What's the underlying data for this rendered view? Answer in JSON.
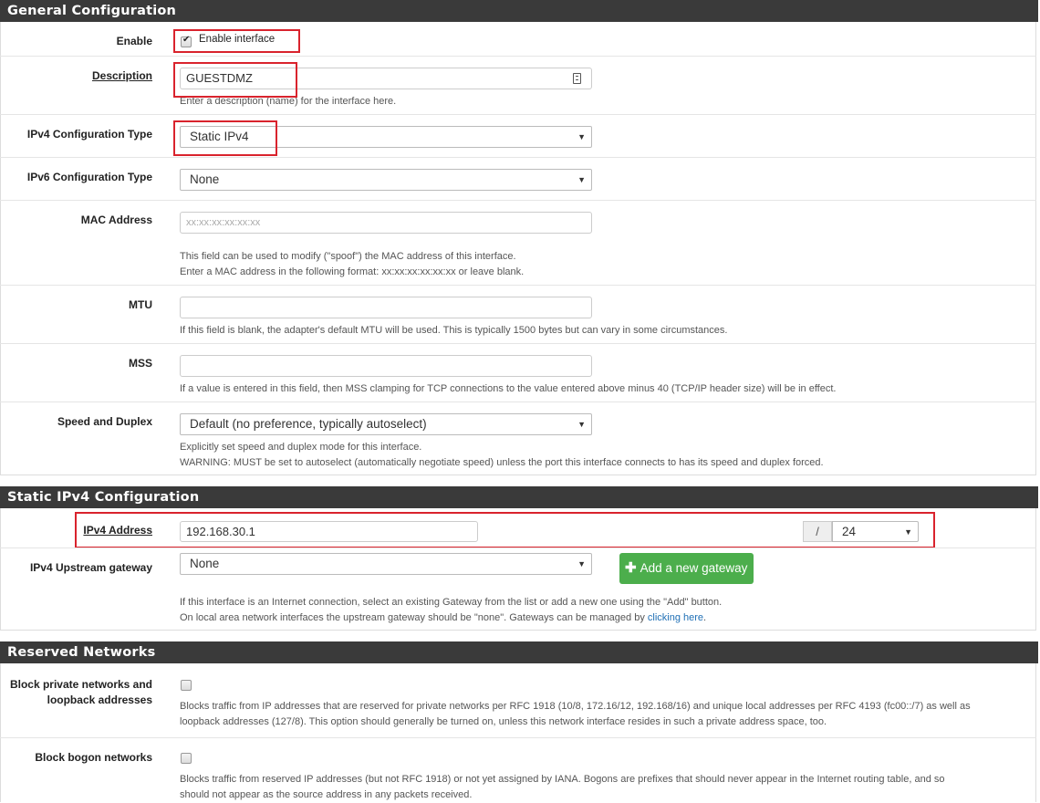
{
  "general": {
    "heading": "General Configuration",
    "enable": {
      "label": "Enable",
      "checkbox_label": "Enable interface",
      "checked": true
    },
    "description": {
      "label": "Description",
      "value": "GUESTDMZ",
      "help": "Enter a description (name) for the interface here."
    },
    "ipv4_type": {
      "label": "IPv4 Configuration Type",
      "value": "Static IPv4"
    },
    "ipv6_type": {
      "label": "IPv6 Configuration Type",
      "value": "None"
    },
    "mac": {
      "label": "MAC Address",
      "placeholder": "xx:xx:xx:xx:xx:xx",
      "help1": "This field can be used to modify (\"spoof\") the MAC address of this interface.",
      "help2": "Enter a MAC address in the following format: xx:xx:xx:xx:xx:xx or leave blank."
    },
    "mtu": {
      "label": "MTU",
      "value": "",
      "help": "If this field is blank, the adapter's default MTU will be used. This is typically 1500 bytes but can vary in some circumstances."
    },
    "mss": {
      "label": "MSS",
      "value": "",
      "help": "If a value is entered in this field, then MSS clamping for TCP connections to the value entered above minus 40 (TCP/IP header size) will be in effect."
    },
    "speed": {
      "label": "Speed and Duplex",
      "value": "Default (no preference, typically autoselect)",
      "help1": "Explicitly set speed and duplex mode for this interface.",
      "help2": "WARNING: MUST be set to autoselect (automatically negotiate speed) unless the port this interface connects to has its speed and duplex forced."
    }
  },
  "static_ipv4": {
    "heading": "Static IPv4 Configuration",
    "address": {
      "label": "IPv4 Address",
      "value": "192.168.30.1",
      "slash": "/",
      "cidr": "24"
    },
    "gateway": {
      "label": "IPv4 Upstream gateway",
      "value": "None",
      "add_button": "Add a new gateway",
      "help1": "If this interface is an Internet connection, select an existing Gateway from the list or add a new one using the \"Add\" button.",
      "help2_prefix": "On local area network interfaces the upstream gateway should be \"none\". Gateways can be managed by ",
      "help2_link": "clicking here",
      "help2_suffix": "."
    }
  },
  "reserved": {
    "heading": "Reserved Networks",
    "private": {
      "label_line1": "Block private networks and",
      "label_line2": "loopback addresses",
      "checked": false,
      "help1": "Blocks traffic from IP addresses that are reserved for private networks per RFC 1918 (10/8, 172.16/12, 192.168/16) and unique local addresses per RFC 4193 (fc00::/7) as well as",
      "help2": "loopback addresses (127/8). This option should generally be turned on, unless this network interface resides in such a private address space, too."
    },
    "bogon": {
      "label": "Block bogon networks",
      "checked": false,
      "help1": "Blocks traffic from reserved IP addresses (but not RFC 1918) or not yet assigned by IANA. Bogons are prefixes that should never appear in the Internet routing table, and so",
      "help2": "should not appear as the source address in any packets received."
    }
  },
  "colors": {
    "heading_bg": "#3a3a3a",
    "highlight": "#d9232d",
    "button_green": "#4cae4c",
    "link": "#1f6fb5"
  }
}
